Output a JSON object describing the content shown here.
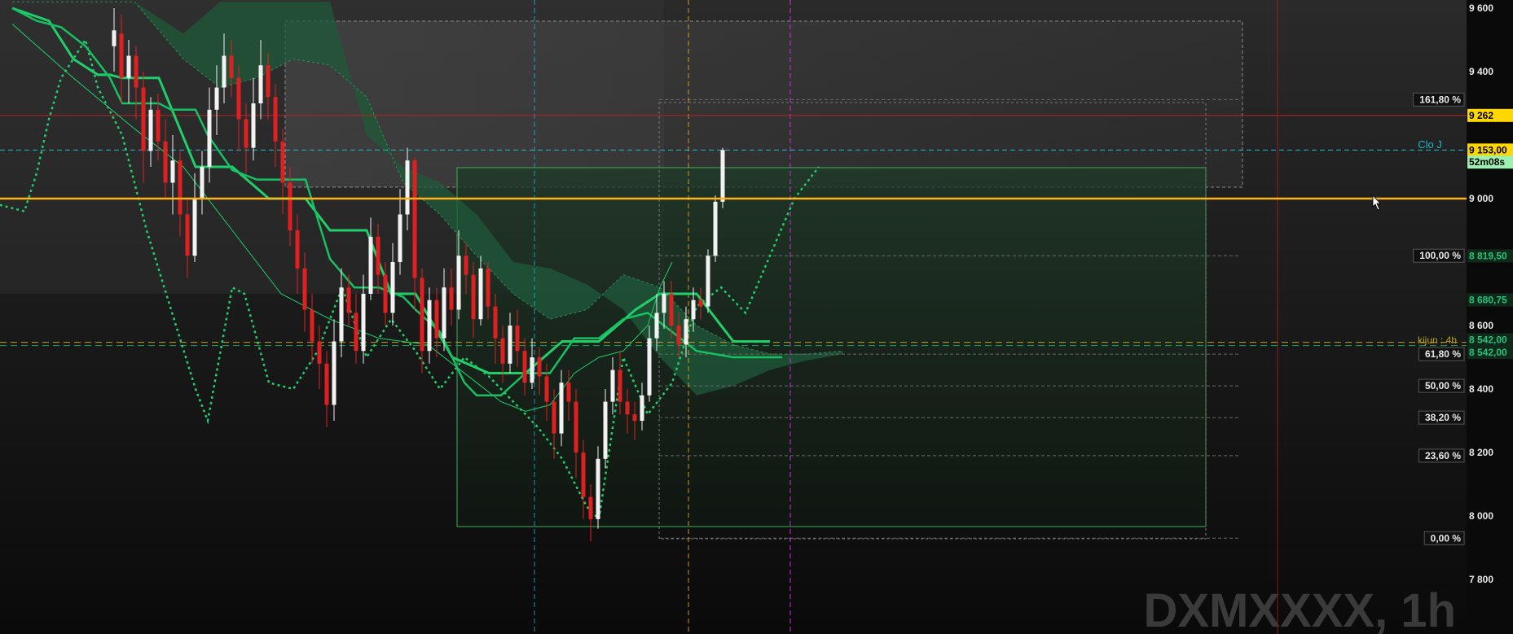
{
  "watermark": "DXMXXXX, 1h",
  "price_axis": {
    "ticks": [
      "9 600",
      "9 400",
      "9 000",
      "8 600",
      "8 400",
      "8 200",
      "8 000",
      "7 800"
    ],
    "ticks_values": [
      9600,
      9400,
      9000,
      8600,
      8400,
      8200,
      8000,
      7800
    ]
  },
  "price_tags": [
    {
      "label": "9 262",
      "value": 9262,
      "bg": "#ffd700",
      "fg": "#000000"
    },
    {
      "label": "9 153,00",
      "value": 9153,
      "bg": "#ffd700",
      "fg": "#000000"
    },
    {
      "label": "52m08s",
      "value": 9115,
      "bg": "#9cf0b0",
      "fg": "#000000"
    },
    {
      "label": "8 819,50",
      "value": 8819.5,
      "bg": "#0f2a1a",
      "fg": "#22c47a"
    },
    {
      "label": "8 680,75",
      "value": 8680.75,
      "bg": "#0f2a1a",
      "fg": "#22c47a"
    },
    {
      "label": "8 542,00",
      "value": 8555,
      "bg": "#0f2a1a",
      "fg": "#22c47a"
    },
    {
      "label": "8 542,00",
      "value": 8515,
      "bg": "#0f2a1a",
      "fg": "#22c47a"
    }
  ],
  "line_labels": {
    "clo_j": "Clo J",
    "kijun": "kijun : 4h"
  },
  "fib_levels": [
    {
      "label": "161,80 %",
      "value": 9312
    },
    {
      "label": "100,00 %",
      "value": 8820
    },
    {
      "label": "61,80 %",
      "value": 8510
    },
    {
      "label": "50,00 %",
      "value": 8410
    },
    {
      "label": "38,20 %",
      "value": 8310
    },
    {
      "label": "23,60 %",
      "value": 8190
    },
    {
      "label": "0,00 %",
      "value": 7930
    }
  ],
  "colors": {
    "background": "#0d0d0d",
    "bull_candle": "#f2f2f2",
    "bear_candle": "#e02020",
    "ichimoku_green": "#1fcf6a",
    "cloud_fill": "#1f5a3a",
    "orange_line": "#ffb31a",
    "cyan_dash": "#1fb8c8",
    "magenta_dash": "#d02fd0",
    "red_line": "#c02020"
  },
  "chart_data": {
    "type": "candlestick",
    "ylim": [
      7620,
      9620
    ],
    "hlines": {
      "orange": 9000,
      "red": 9262,
      "clo_j": 9153,
      "kijun_4h": 8542
    },
    "candles": [
      [
        9480,
        9530,
        9600,
        9400
      ],
      [
        9520,
        9380,
        9580,
        9300
      ],
      [
        9380,
        9450,
        9500,
        9300
      ],
      [
        9450,
        9350,
        9480,
        9250
      ],
      [
        9350,
        9150,
        9400,
        9050
      ],
      [
        9150,
        9280,
        9320,
        9100
      ],
      [
        9280,
        9180,
        9330,
        9120
      ],
      [
        9180,
        9050,
        9250,
        9000
      ],
      [
        9050,
        9120,
        9200,
        8950
      ],
      [
        9120,
        8950,
        9150,
        8880
      ],
      [
        8950,
        8820,
        9000,
        8750
      ],
      [
        8820,
        9000,
        9080,
        8800
      ],
      [
        9000,
        9100,
        9150,
        8950
      ],
      [
        9100,
        9280,
        9350,
        9050
      ],
      [
        9280,
        9350,
        9420,
        9200
      ],
      [
        9350,
        9450,
        9520,
        9300
      ],
      [
        9450,
        9380,
        9500,
        9320
      ],
      [
        9380,
        9250,
        9420,
        9150
      ],
      [
        9250,
        9160,
        9300,
        9080
      ],
      [
        9160,
        9300,
        9380,
        9120
      ],
      [
        9300,
        9420,
        9500,
        9250
      ],
      [
        9420,
        9320,
        9460,
        9250
      ],
      [
        9320,
        9180,
        9360,
        9100
      ],
      [
        9180,
        9050,
        9220,
        8950
      ],
      [
        9050,
        8900,
        9100,
        8850
      ],
      [
        8900,
        8780,
        8950,
        8700
      ],
      [
        8780,
        8650,
        8830,
        8580
      ],
      [
        8650,
        8550,
        8700,
        8480
      ],
      [
        8550,
        8480,
        8600,
        8400
      ],
      [
        8480,
        8350,
        8520,
        8280
      ],
      [
        8350,
        8550,
        8620,
        8300
      ],
      [
        8550,
        8720,
        8780,
        8500
      ],
      [
        8720,
        8640,
        8760,
        8600
      ],
      [
        8640,
        8520,
        8700,
        8480
      ],
      [
        8520,
        8700,
        8760,
        8480
      ],
      [
        8700,
        8880,
        8940,
        8680
      ],
      [
        8880,
        8760,
        8920,
        8700
      ],
      [
        8760,
        8640,
        8800,
        8600
      ],
      [
        8640,
        8800,
        8860,
        8600
      ],
      [
        8800,
        8950,
        9030,
        8760
      ],
      [
        8950,
        9120,
        9160,
        8900
      ],
      [
        9120,
        8750,
        9130,
        8650
      ],
      [
        8750,
        8520,
        8780,
        8450
      ],
      [
        8520,
        8680,
        8720,
        8480
      ],
      [
        8680,
        8560,
        8720,
        8500
      ],
      [
        8560,
        8720,
        8780,
        8520
      ],
      [
        8720,
        8650,
        8780,
        8600
      ],
      [
        8650,
        8820,
        8900,
        8620
      ],
      [
        8820,
        8760,
        8860,
        8700
      ],
      [
        8760,
        8620,
        8800,
        8560
      ],
      [
        8620,
        8780,
        8820,
        8600
      ],
      [
        8780,
        8660,
        8800,
        8620
      ],
      [
        8660,
        8560,
        8700,
        8480
      ],
      [
        8560,
        8480,
        8600,
        8420
      ],
      [
        8480,
        8600,
        8640,
        8450
      ],
      [
        8600,
        8520,
        8650,
        8470
      ],
      [
        8520,
        8420,
        8560,
        8380
      ],
      [
        8420,
        8500,
        8560,
        8400
      ],
      [
        8500,
        8440,
        8530,
        8380
      ],
      [
        8440,
        8360,
        8480,
        8300
      ],
      [
        8360,
        8260,
        8400,
        8180
      ],
      [
        8260,
        8420,
        8460,
        8220
      ],
      [
        8420,
        8360,
        8460,
        8300
      ],
      [
        8360,
        8200,
        8400,
        8120
      ],
      [
        8200,
        8060,
        8240,
        7990
      ],
      [
        8060,
        7990,
        8100,
        7920
      ],
      [
        7990,
        8180,
        8220,
        7960
      ],
      [
        8180,
        8360,
        8400,
        8150
      ],
      [
        8360,
        8460,
        8500,
        8320
      ],
      [
        8460,
        8360,
        8520,
        8320
      ],
      [
        8360,
        8320,
        8400,
        8260
      ],
      [
        8320,
        8300,
        8360,
        8240
      ],
      [
        8300,
        8380,
        8420,
        8270
      ],
      [
        8380,
        8560,
        8600,
        8360
      ],
      [
        8560,
        8640,
        8700,
        8520
      ],
      [
        8640,
        8700,
        8740,
        8590
      ],
      [
        8700,
        8600,
        8740,
        8560
      ],
      [
        8600,
        8540,
        8640,
        8500
      ],
      [
        8540,
        8620,
        8660,
        8500
      ],
      [
        8620,
        8680,
        8720,
        8580
      ],
      [
        8680,
        8660,
        8720,
        8620
      ],
      [
        8660,
        8820,
        8840,
        8640
      ],
      [
        8820,
        8990,
        9010,
        8800
      ],
      [
        8990,
        9153,
        9160,
        8970
      ]
    ],
    "cloud_upper": [
      [
        0,
        9620
      ],
      [
        20,
        9620
      ],
      [
        28,
        9440
      ],
      [
        34,
        9350
      ],
      [
        40,
        9380
      ],
      [
        46,
        9440
      ],
      [
        52,
        9420
      ],
      [
        58,
        9320
      ],
      [
        64,
        9050
      ],
      [
        70,
        8950
      ],
      [
        76,
        8820
      ],
      [
        82,
        8700
      ],
      [
        88,
        8620
      ],
      [
        94,
        8650
      ],
      [
        100,
        8760
      ],
      [
        106,
        8720
      ],
      [
        112,
        8600
      ],
      [
        118,
        8540
      ],
      [
        124,
        8510
      ],
      [
        130,
        8510
      ],
      [
        136,
        8520
      ]
    ],
    "cloud_lower": [
      [
        0,
        9620
      ],
      [
        20,
        9620
      ],
      [
        28,
        9520
      ],
      [
        34,
        9620
      ],
      [
        40,
        9620
      ],
      [
        46,
        9620
      ],
      [
        52,
        9620
      ],
      [
        58,
        9200
      ],
      [
        64,
        9100
      ],
      [
        70,
        9050
      ],
      [
        76,
        8950
      ],
      [
        82,
        8800
      ],
      [
        88,
        8780
      ],
      [
        94,
        8730
      ],
      [
        100,
        8650
      ],
      [
        106,
        8500
      ],
      [
        112,
        8380
      ],
      [
        118,
        8410
      ],
      [
        124,
        8460
      ],
      [
        130,
        8490
      ],
      [
        136,
        8510
      ]
    ],
    "tenkan": [
      [
        0,
        9600
      ],
      [
        4,
        9560
      ],
      [
        8,
        9540
      ],
      [
        12,
        9480
      ],
      [
        16,
        9380
      ],
      [
        18,
        9300
      ],
      [
        24,
        9300
      ],
      [
        26,
        9280
      ],
      [
        30,
        9280
      ],
      [
        32,
        9200
      ],
      [
        36,
        9090
      ],
      [
        40,
        9060
      ],
      [
        48,
        9060
      ],
      [
        52,
        8810
      ],
      [
        56,
        8720
      ],
      [
        60,
        8720
      ],
      [
        64,
        8690
      ],
      [
        66,
        8650
      ],
      [
        70,
        8580
      ],
      [
        74,
        8420
      ],
      [
        76,
        8380
      ],
      [
        80,
        8380
      ],
      [
        84,
        8450
      ],
      [
        88,
        8450
      ],
      [
        92,
        8560
      ],
      [
        96,
        8560
      ],
      [
        100,
        8620
      ],
      [
        104,
        8640
      ],
      [
        108,
        8580
      ],
      [
        112,
        8520
      ],
      [
        118,
        8500
      ],
      [
        126,
        8500
      ]
    ],
    "kijun": [
      [
        0,
        9600
      ],
      [
        6,
        9560
      ],
      [
        10,
        9440
      ],
      [
        14,
        9390
      ],
      [
        16,
        9390
      ],
      [
        18,
        9380
      ],
      [
        24,
        9380
      ],
      [
        30,
        9100
      ],
      [
        36,
        9100
      ],
      [
        42,
        9000
      ],
      [
        48,
        9000
      ],
      [
        52,
        8900
      ],
      [
        58,
        8900
      ],
      [
        62,
        8700
      ],
      [
        66,
        8700
      ],
      [
        72,
        8500
      ],
      [
        78,
        8450
      ],
      [
        84,
        8450
      ],
      [
        90,
        8550
      ],
      [
        96,
        8550
      ],
      [
        102,
        8650
      ],
      [
        106,
        8700
      ],
      [
        112,
        8700
      ],
      [
        118,
        8550
      ],
      [
        124,
        8550
      ]
    ],
    "chikou": [
      [
        -4,
        9100
      ],
      [
        -2,
        8980
      ],
      [
        2,
        8960
      ],
      [
        4,
        9080
      ],
      [
        6,
        9250
      ],
      [
        8,
        9380
      ],
      [
        12,
        9500
      ],
      [
        14,
        9350
      ],
      [
        18,
        9200
      ],
      [
        22,
        8900
      ],
      [
        26,
        8650
      ],
      [
        30,
        8400
      ],
      [
        32,
        8300
      ],
      [
        36,
        8720
      ],
      [
        38,
        8700
      ],
      [
        42,
        8420
      ],
      [
        46,
        8400
      ],
      [
        50,
        8520
      ],
      [
        54,
        8720
      ],
      [
        58,
        8500
      ],
      [
        62,
        8620
      ],
      [
        66,
        8520
      ],
      [
        70,
        8400
      ],
      [
        74,
        8500
      ],
      [
        78,
        8440
      ],
      [
        82,
        8360
      ],
      [
        86,
        8280
      ],
      [
        90,
        8180
      ],
      [
        94,
        8030
      ],
      [
        96,
        7990
      ],
      [
        100,
        8500
      ],
      [
        104,
        8320
      ],
      [
        108,
        8420
      ],
      [
        112,
        8660
      ],
      [
        116,
        8720
      ],
      [
        120,
        8640
      ],
      [
        124,
        8820
      ],
      [
        128,
        9000
      ],
      [
        132,
        9100
      ]
    ],
    "thin_green": [
      [
        0,
        9550
      ],
      [
        10,
        9380
      ],
      [
        20,
        9220
      ],
      [
        28,
        9100
      ],
      [
        36,
        8900
      ],
      [
        44,
        8700
      ],
      [
        52,
        8620
      ],
      [
        60,
        8560
      ],
      [
        68,
        8540
      ],
      [
        76,
        8420
      ],
      [
        80,
        8360
      ],
      [
        84,
        8330
      ],
      [
        88,
        8350
      ],
      [
        92,
        8450
      ],
      [
        96,
        8500
      ],
      [
        100,
        8520
      ],
      [
        104,
        8600
      ],
      [
        106,
        8720
      ],
      [
        108,
        8800
      ]
    ]
  }
}
